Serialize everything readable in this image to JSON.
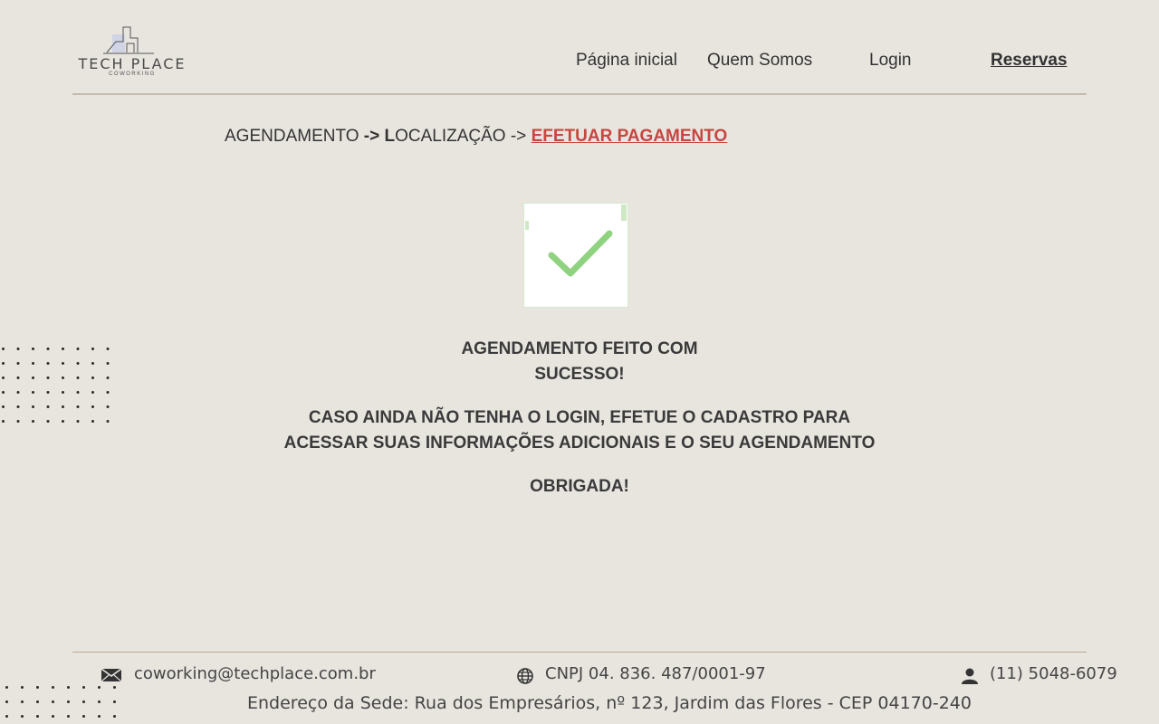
{
  "logo": {
    "title": "TECH PLACE",
    "subtitle": "COWORKING"
  },
  "nav": {
    "home": "Página inicial",
    "about": "Quem Somos",
    "login": "Login",
    "reservations": "Reservas"
  },
  "breadcrumb": {
    "step1": "AGENDAMENTO ",
    "arrow1": "->",
    "step2_initial": " L",
    "step2_rest": "OCALIZAÇÃO -> ",
    "current": "EFETUAR PAGAMENTO"
  },
  "message": {
    "success_line1": "AGENDAMENTO FEITO COM",
    "success_line2": "SUCESSO!",
    "info_line1": "CASO AINDA NÃO TENHA O LOGIN, EFETUE O CADASTRO PARA",
    "info_line2": "ACESSAR SUAS INFORMAÇÕES ADICIONAIS E O SEU AGENDAMENTO",
    "thanks": "OBRIGADA!"
  },
  "footer": {
    "email": "coworking@techplace.com.br",
    "cnpj": "CNPJ 04. 836. 487/0001-97",
    "phone": "(11) 5048-6079",
    "address": "Endereço da Sede: Rua dos Empresários, nº 123, Jardim das Flores - CEP 04170-240"
  },
  "colors": {
    "background": "#e8e5df",
    "accent_red": "#c8463f",
    "check_green": "#8fd27f",
    "divider": "#c7b9ab"
  },
  "icons": [
    "check-icon",
    "mail-icon",
    "globe-icon",
    "user-icon",
    "building-logo-icon"
  ]
}
